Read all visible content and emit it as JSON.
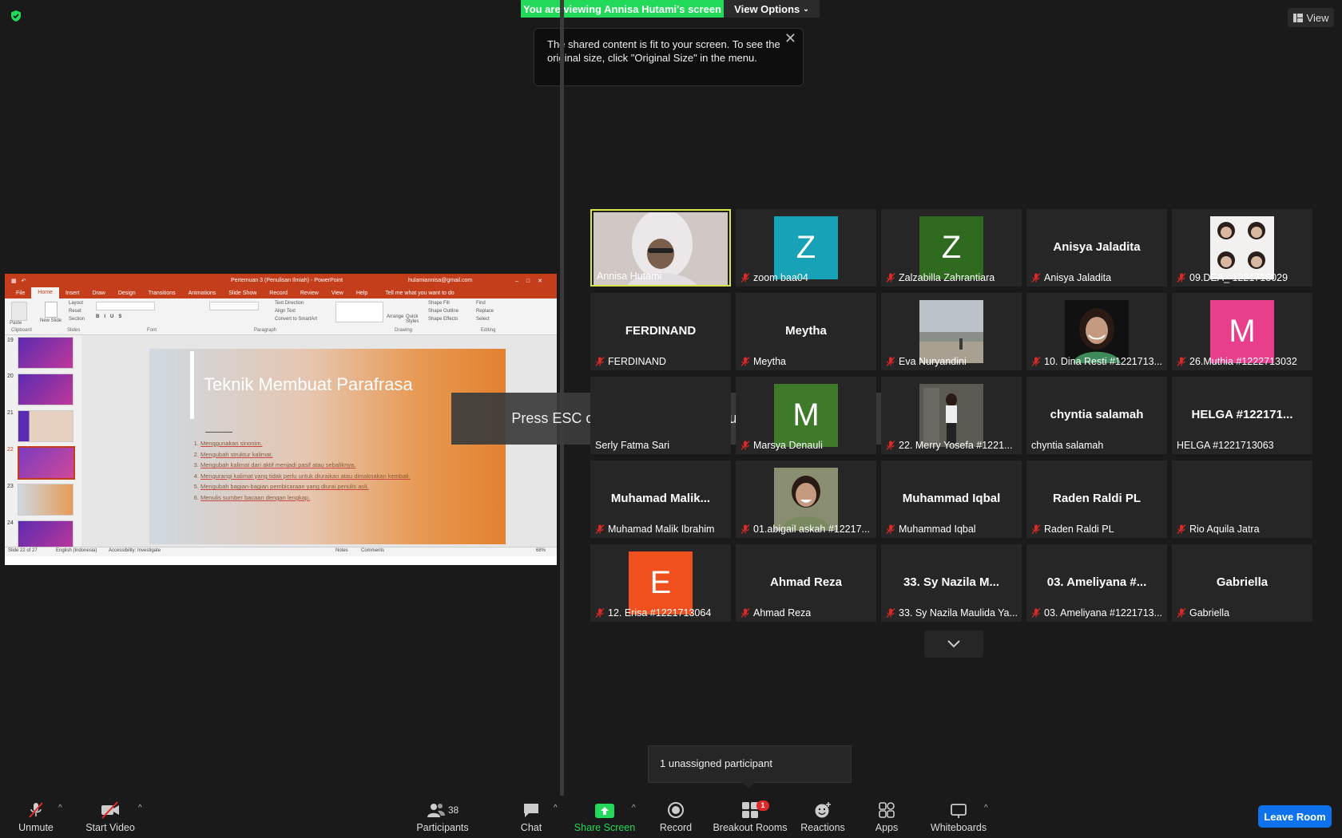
{
  "topbar": {
    "viewing_banner": "You are viewing Annisa Hutami's screen",
    "view_options": "View Options",
    "view_button": "View"
  },
  "tooltip": {
    "text": "The shared content is fit to your screen. To see the original size, click \"Original Size\" in the menu."
  },
  "fullscreen_notice": "Press ESC or double-click to exit full screen mode",
  "shared_screen": {
    "window_title": "Pertemuan 3 (Penulisan Ilmiah) - PowerPoint",
    "account": "hulamiannisa@gmail.com",
    "tabs": [
      "File",
      "Home",
      "Insert",
      "Draw",
      "Design",
      "Transitions",
      "Animations",
      "Slide Show",
      "Record",
      "Review",
      "View",
      "Help"
    ],
    "tell_me": "Tell me what you want to do",
    "ribbon_groups": [
      "Clipboard",
      "Slides",
      "Font",
      "Paragraph",
      "Drawing",
      "Editing"
    ],
    "ribbon_items": {
      "paste": "Paste",
      "new_slide": "New Slide",
      "layout": "Layout",
      "reset": "Reset",
      "section": "Section",
      "text_direction": "Text Direction",
      "align_text": "Align Text",
      "convert_smartart": "Convert to SmartArt",
      "arrange": "Arrange",
      "quick_styles": "Quick Styles",
      "shape_fill": "Shape Fill",
      "shape_outline": "Shape Outline",
      "shape_effects": "Shape Effects",
      "find": "Find",
      "replace": "Replace",
      "select": "Select"
    },
    "thumb_numbers": [
      "19",
      "20",
      "21",
      "22",
      "23",
      "24"
    ],
    "slide_title": "Teknik Membuat Parafrasa",
    "slide_items": [
      "Menggunakan sinonim.",
      "Mengubah struktur kalimat.",
      "Mengubah kalimat dari aktif menjadi pasif atau sebaliknya.",
      "Mengurangi kalimat yang tidak perlu untuk diuraikan atau dimaknakan kembali.",
      "Mengubah bagian-bagian pembicaraan yang diurai penulis asli.",
      "Menulis sumber bacaan dengan lengkap."
    ],
    "status_left": "Slide 22 of 27",
    "status_lang": "English (Indonesia)",
    "status_access": "Accessibility: Investigate",
    "status_notes": "Notes",
    "status_comments": "Comments",
    "zoom": "68%"
  },
  "participants": [
    {
      "display": "photo",
      "name": "Annisa Hutami",
      "active": true,
      "muted": false
    },
    {
      "display": "avatar",
      "letter": "Z",
      "color": "#17a2b8",
      "name": "zoom baa04",
      "muted": true
    },
    {
      "display": "avatar",
      "letter": "Z",
      "color": "#2e6b1e",
      "name": "Zalzabilla Zahrantiara",
      "muted": true
    },
    {
      "display": "text",
      "big": "Anisya Jaladita",
      "name": "Anisya Jaladita",
      "muted": true
    },
    {
      "display": "photo",
      "name": "09.DEA_ 1221713029",
      "muted": true
    },
    {
      "display": "text",
      "big": "FERDINAND",
      "name": "FERDINAND",
      "muted": true
    },
    {
      "display": "text",
      "big": "Meytha",
      "name": "Meytha",
      "muted": true
    },
    {
      "display": "photo",
      "name": "Eva Nuryandini",
      "muted": true
    },
    {
      "display": "photo",
      "name": "10. Dina Resti #1221713...",
      "muted": true
    },
    {
      "display": "avatar",
      "letter": "M",
      "color": "#e83e8c",
      "name": "26.Muthia #1222713032",
      "muted": true
    },
    {
      "display": "text",
      "big": "",
      "name": "Serly Fatma Sari",
      "muted": false
    },
    {
      "display": "avatar",
      "letter": "M",
      "color": "#3e7a2a",
      "name": "Marsya Denauli",
      "muted": true
    },
    {
      "display": "photo",
      "name": "22. Merry Yosefa #1221...",
      "muted": true
    },
    {
      "display": "text",
      "big": "chyntia salamah",
      "name": "chyntia salamah",
      "muted": false
    },
    {
      "display": "text",
      "big": "HELGA #122171...",
      "name": "HELGA #1221713063",
      "muted": false
    },
    {
      "display": "text",
      "big": "Muhamad  Malik...",
      "name": "Muhamad Malik Ibrahim",
      "muted": true
    },
    {
      "display": "photo",
      "name": "01.abigail askah #12217...",
      "muted": true
    },
    {
      "display": "text",
      "big": "Muhammad Iqbal",
      "name": "Muhammad Iqbal",
      "muted": true
    },
    {
      "display": "text",
      "big": "Raden Raldi PL",
      "name": "Raden Raldi PL",
      "muted": true
    },
    {
      "display": "text",
      "big": "",
      "name": "Rio Aquila Jatra",
      "muted": true
    },
    {
      "display": "avatar",
      "letter": "E",
      "color": "#f0501e",
      "name": "12. Erisa #1221713064",
      "muted": true
    },
    {
      "display": "text",
      "big": "Ahmad Reza",
      "name": "Ahmad Reza",
      "muted": true
    },
    {
      "display": "text",
      "big": "33. Sy Nazila M...",
      "name": "33. Sy Nazila Maulida Ya...",
      "muted": true
    },
    {
      "display": "text",
      "big": "03. Ameliyana #...",
      "name": "03. Ameliyana #1221713...",
      "muted": true
    },
    {
      "display": "text",
      "big": "Gabriella",
      "name": "Gabriella",
      "muted": true
    }
  ],
  "unassigned": "1 unassigned participant",
  "toolbar": {
    "unmute": "Unmute",
    "start_video": "Start Video",
    "participants": "Participants",
    "participants_count": "38",
    "chat": "Chat",
    "share_screen": "Share Screen",
    "record": "Record",
    "breakout_rooms": "Breakout Rooms",
    "breakout_badge": "1",
    "reactions": "Reactions",
    "apps": "Apps",
    "whiteboards": "Whiteboards",
    "leave_room": "Leave Room"
  },
  "colors": {
    "green": "#23d959",
    "blue": "#0e72ed",
    "active_border": "#d6e34a",
    "muted_red": "#e02828"
  }
}
